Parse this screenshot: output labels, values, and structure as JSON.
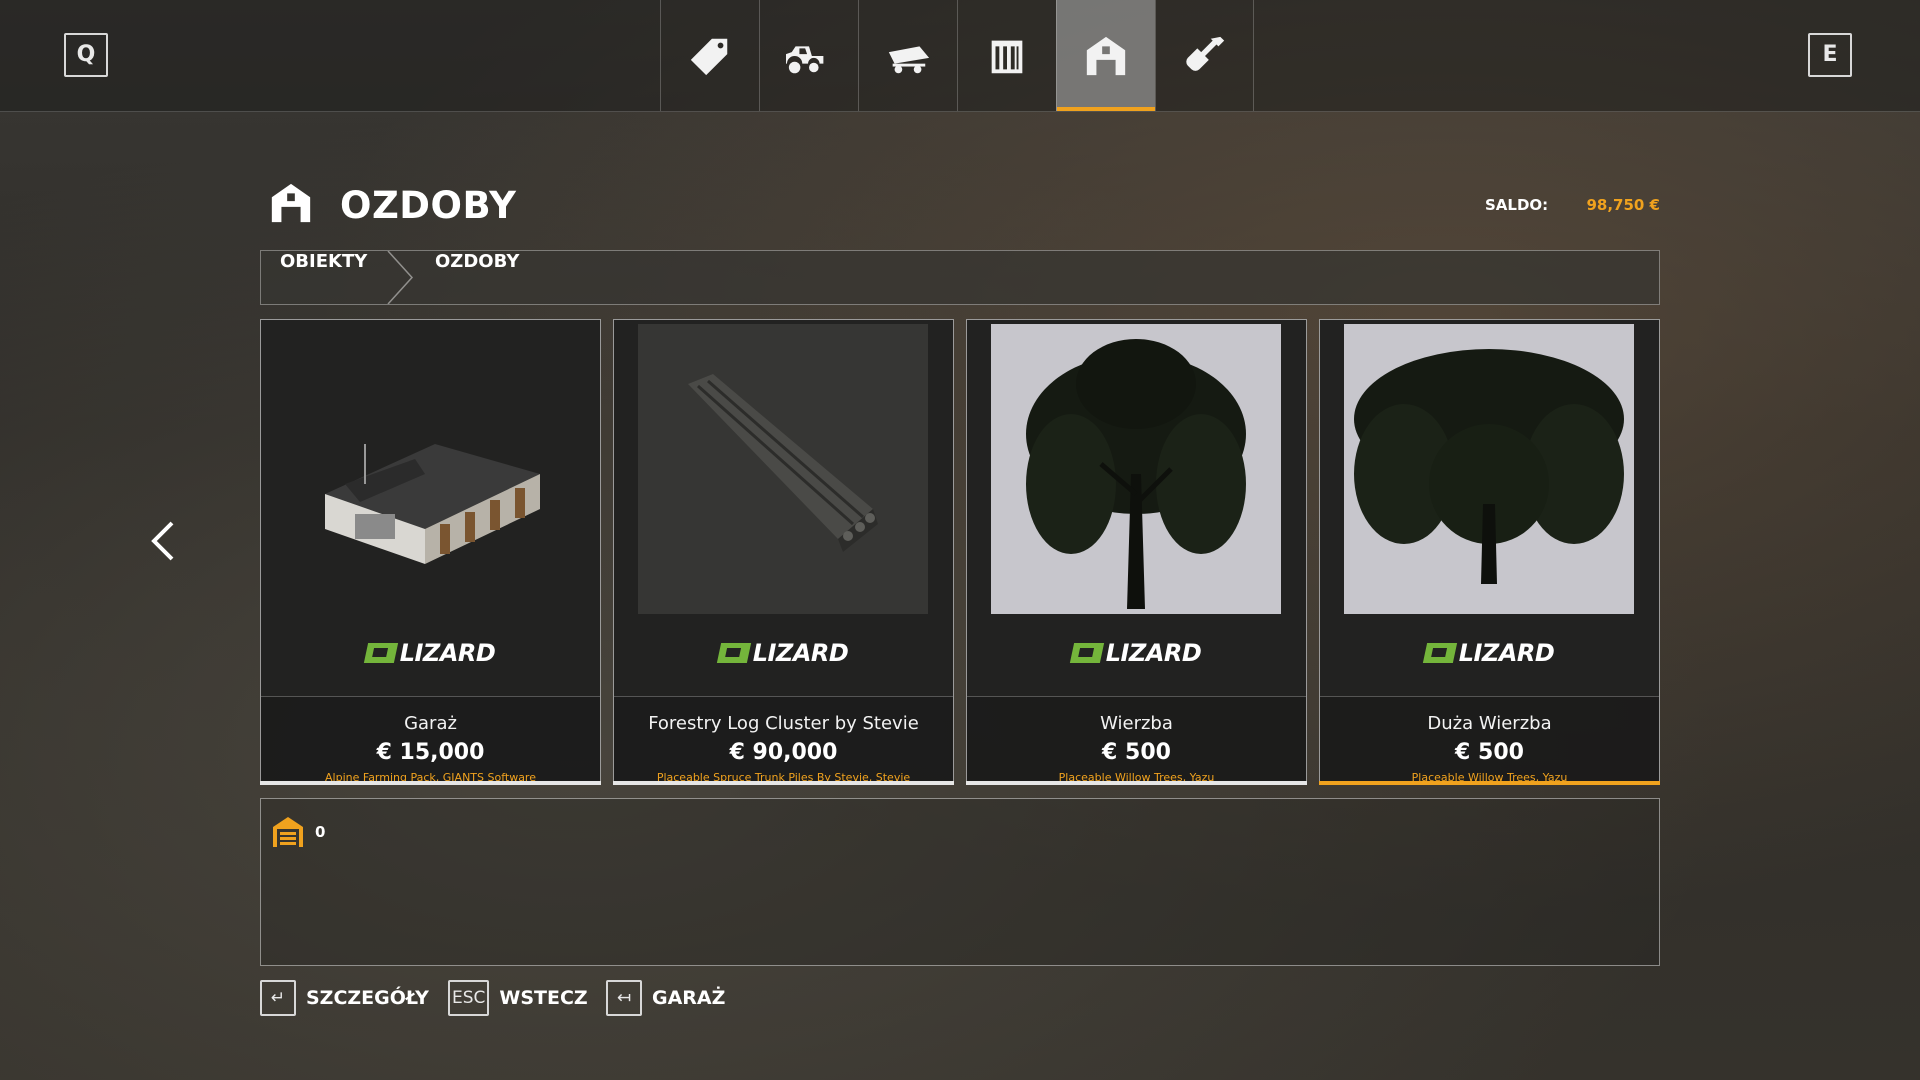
{
  "topbar": {
    "left_key": "Q",
    "right_key": "E",
    "tabs": [
      {
        "icon": "price-tag-icon"
      },
      {
        "icon": "tractor-icon"
      },
      {
        "icon": "trailer-icon"
      },
      {
        "icon": "silo-icon"
      },
      {
        "icon": "barn-icon",
        "active": true
      },
      {
        "icon": "shovel-icon"
      }
    ]
  },
  "header": {
    "title": "OZDOBY",
    "saldo_label": "SALDO:",
    "saldo_value": "98,750 €"
  },
  "breadcrumb": [
    "OBIEKTY",
    "OZDOBY"
  ],
  "items": [
    {
      "name": "Garaż",
      "price": "€ 15,000",
      "source": "Alpine Farming Pack, GIANTS Software",
      "brand": "LIZARD",
      "selected": false
    },
    {
      "name": "Forestry Log Cluster by Stevie",
      "price": "€ 90,000",
      "source": "Placeable Spruce Trunk Piles By Stevie, Stevie",
      "brand": "LIZARD",
      "selected": false
    },
    {
      "name": "Wierzba",
      "price": "€ 500",
      "source": "Placeable Willow Trees, Yazu",
      "brand": "LIZARD",
      "selected": false
    },
    {
      "name": "Duża Wierzba",
      "price": "€ 500",
      "source": "Placeable Willow Trees, Yazu",
      "brand": "LIZARD",
      "selected": true
    }
  ],
  "info_panel": {
    "count_icon": "storage-icon",
    "count": "0"
  },
  "hints": [
    {
      "key": "↵",
      "label": "SZCZEGÓŁY"
    },
    {
      "key": "ESC",
      "label": "WSTECZ"
    },
    {
      "key": "↤",
      "label": "GARAŻ"
    }
  ],
  "colors": {
    "accent": "#f0a21e",
    "brand_green": "#74b53b"
  }
}
